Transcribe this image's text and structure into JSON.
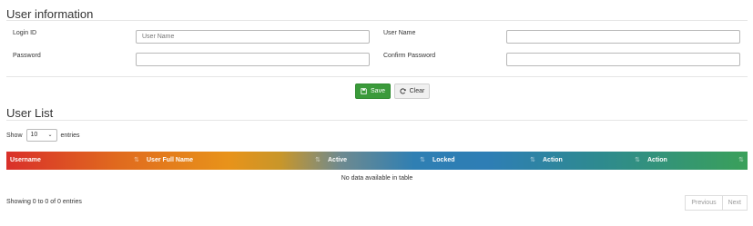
{
  "user_info": {
    "title": "User information",
    "login_id_label": "Login ID",
    "login_id_placeholder": "User Name",
    "login_id_value": "",
    "user_name_label": "User Name",
    "user_name_value": "",
    "password_label": "Password",
    "password_value": "",
    "confirm_password_label": "Confirm Password",
    "confirm_password_value": ""
  },
  "actions": {
    "save_label": "Save",
    "clear_label": "Clear",
    "save_color": "#3a9a3a"
  },
  "user_list": {
    "title": "User List",
    "show_label": "Show",
    "entries_label": "entries",
    "page_length": "10",
    "columns": [
      "Username",
      "User Full Name",
      "Active",
      "Locked",
      "Action",
      "Action"
    ],
    "empty_message": "No data available in table",
    "info_text": "Showing 0 to 0 of 0 entries",
    "previous_label": "Previous",
    "next_label": "Next"
  }
}
